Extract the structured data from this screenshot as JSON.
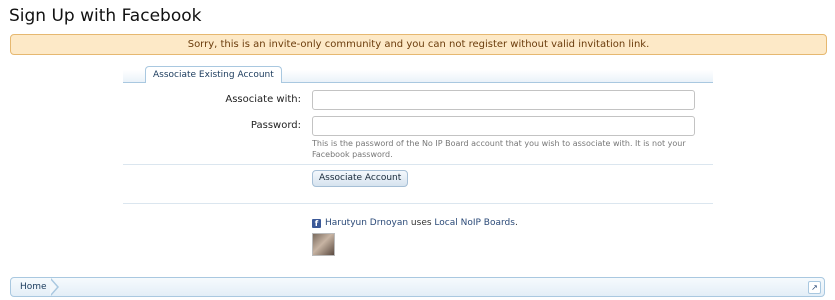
{
  "page": {
    "title": "Sign Up with Facebook",
    "error": "Sorry, this is an invite-only community and you can not register without valid invitation link."
  },
  "tabs": [
    {
      "label": "Associate Existing Account"
    }
  ],
  "form": {
    "associate_label": "Associate with:",
    "associate_value": "",
    "password_label": "Password:",
    "password_value": "",
    "password_hint": "This is the password of the No IP Board account that you wish to associate with. It is not your Facebook password.",
    "submit_label": "Associate Account"
  },
  "facebook": {
    "icon": "facebook-icon",
    "brand_color": "#3b5998",
    "user_name": "Harutyun Drnoyan",
    "uses_text": "uses",
    "app_name": "Local NoIP Boards",
    "period": "."
  },
  "breadcrumb": {
    "items": [
      {
        "label": "Home"
      }
    ],
    "jump_icon": "arrow-up-right-icon"
  }
}
